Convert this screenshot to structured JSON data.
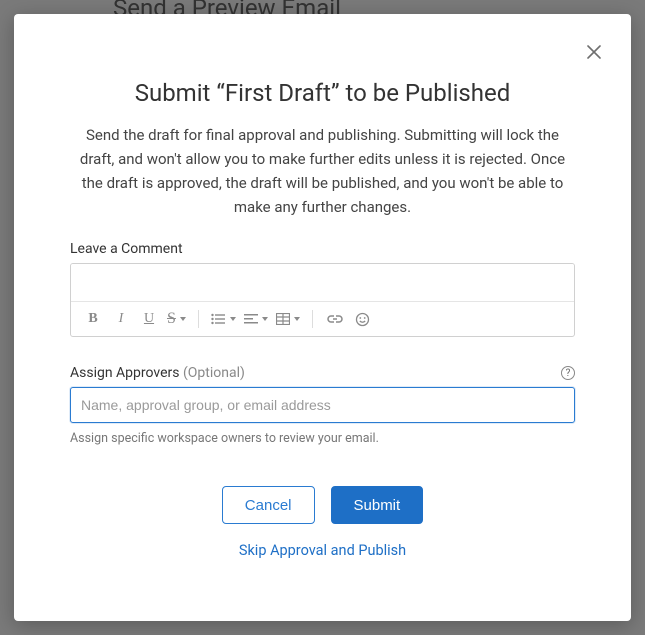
{
  "background": {
    "heading_behind": "Send a Preview Email"
  },
  "modal": {
    "title": "Submit “First Draft” to be Published",
    "description": "Send the draft for final approval and publishing. Submitting will lock the draft, and won't allow you to make further edits unless it is rejected. Once the draft is approved, the draft will be published, and you won't be able to make any further changes.",
    "comment": {
      "label": "Leave a Comment",
      "value": ""
    },
    "approvers": {
      "label": "Assign Approvers",
      "optional_suffix": "(Optional)",
      "placeholder": "Name, approval group, or email address",
      "value": "",
      "helper": "Assign specific workspace owners to review your email.",
      "help_icon_tooltip": "?"
    },
    "actions": {
      "cancel": "Cancel",
      "submit": "Submit",
      "skip": "Skip Approval and Publish"
    },
    "close_label": "Close",
    "editor_toolbar": {
      "bold": "B",
      "italic": "I",
      "underline": "U",
      "strike": "S",
      "list": "list",
      "align": "align",
      "table": "table",
      "link": "link",
      "emoji": "emoji"
    }
  }
}
